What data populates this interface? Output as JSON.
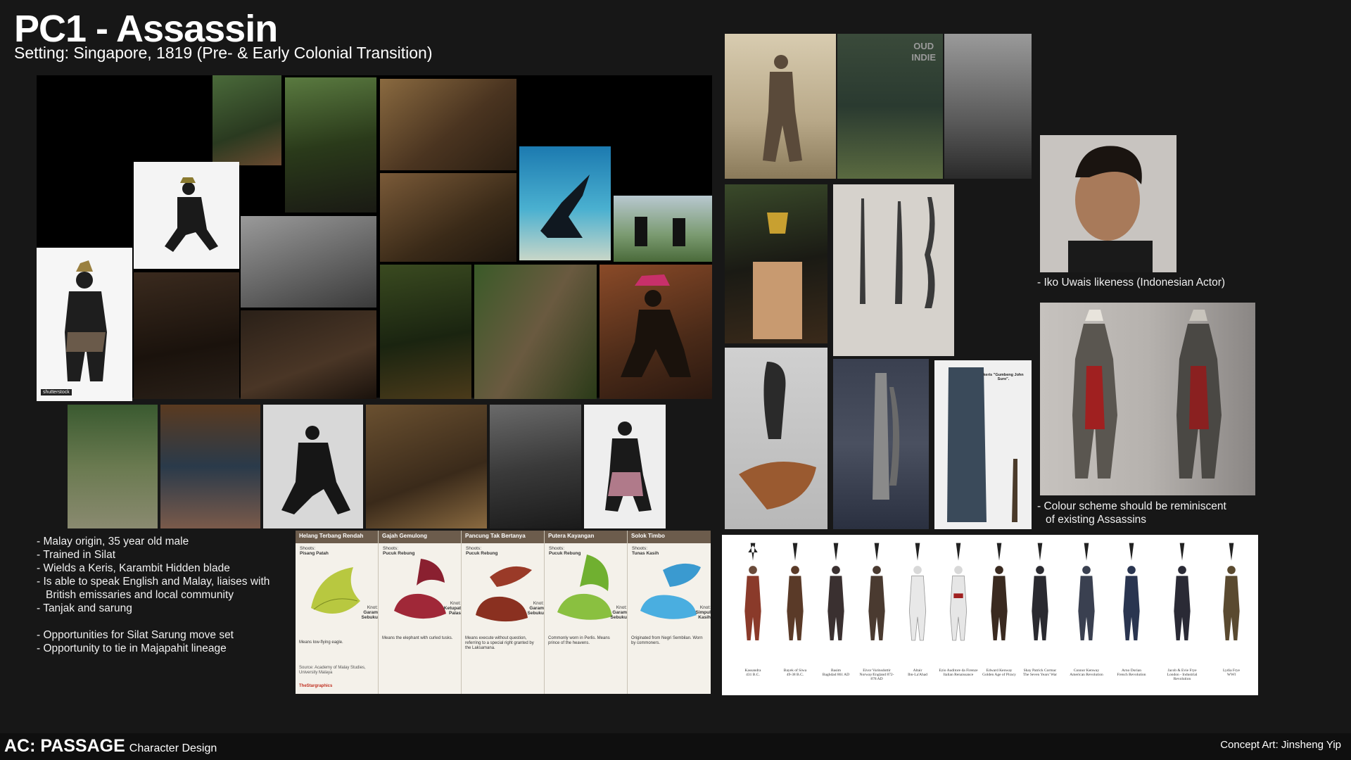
{
  "header": {
    "title": "PC1 - Assassin",
    "subtitle": "Setting: Singapore, 1819 (Pre- & Early Colonial Transition)"
  },
  "notes": {
    "items": [
      "-  Malay origin, 35 year old male",
      "-  Trained in Silat",
      "-  Wields a Keris, Karambit Hidden blade",
      "-  Is able to speak English and Malay, liaises with",
      "British emissaries and local community",
      "-  Tanjak and sarung",
      "",
      "-  Opportunities for Silat Sarung move set",
      "-  Opportunity to tie in Majapahit lineage"
    ]
  },
  "captions": {
    "actor": "-  Iko Uwais likeness (Indonesian Actor)",
    "colour_line1": "-  Colour scheme should be reminiscent",
    "colour_line2": "of existing Assassins"
  },
  "watermarks": {
    "shutterstock": "shutterstock",
    "oud": "OUD",
    "indie": "INDIE"
  },
  "keris_note": {
    "title": "keris \"Gumbeng John Suro\"."
  },
  "tanjak": {
    "columns": [
      {
        "name": "Helang Terbang Rendah",
        "shoots_label": "Shoots:",
        "shoots": "Pisang Patah",
        "knot_label": "Knot:",
        "knot": "Garam Sebuku",
        "desc": "Means low-flying eagle."
      },
      {
        "name": "Gajah Gemulong",
        "shoots_label": "Shoots:",
        "shoots": "Pucuk Rebung",
        "knot_label": "Knot:",
        "knot": "Ketupat Palas",
        "desc": "Means the elephant with curled tusks."
      },
      {
        "name": "Pancung Tak Bertanya",
        "shoots_label": "Shoots:",
        "shoots": "Pucuk Rebung",
        "knot_label": "Knot:",
        "knot": "Garam Sebuku",
        "desc": "Means execute without question, referring to a special right granted by the Laksamana."
      },
      {
        "name": "Putera Kayangan",
        "shoots_label": "Shoots:",
        "shoots": "Pucuk Rebung",
        "knot_label": "Knot:",
        "knot": "Garam Sebuku",
        "desc": "Commonly worn in Perlis. Means prince of the heavens."
      },
      {
        "name": "Solok Timbo",
        "shoots_label": "Shoots:",
        "shoots": "Tunas Kasih",
        "knot_label": "Knot:",
        "knot": "Simpul Kasih",
        "desc": "Originated from Negri Sembilan. Worn by commoners."
      }
    ],
    "source": "Source: Academy of Malay Studies, University Malaya",
    "brand": "TheStargraphics"
  },
  "lineup": {
    "figures": [
      {
        "name": "Kassandra",
        "era": "431 B.C.",
        "color": "#8a3a2a"
      },
      {
        "name": "Bayek of Siwa",
        "era": "49-38 B.C.",
        "color": "#5a3a28"
      },
      {
        "name": "Basim",
        "era": "Baghdad 861 AD",
        "color": "#3a3030"
      },
      {
        "name": "Eivor Varinsdottir",
        "era": "Norway/England 872-878 AD",
        "color": "#4a3a30"
      },
      {
        "name": "Altair",
        "era": "Ibn-La'Ahad",
        "color": "#e8e8e8"
      },
      {
        "name": "Ezio Auditore da Firenze",
        "era": "Italian Renaissance",
        "color": "#e6e6e6"
      },
      {
        "name": "Edward Kenway",
        "era": "Golden Age of Piracy",
        "color": "#3a2a20"
      },
      {
        "name": "Shay Patrick Cormac",
        "era": "The Seven Years' War",
        "color": "#2a2a30"
      },
      {
        "name": "Connor Kenway",
        "era": "American Revolution",
        "color": "#3a4050"
      },
      {
        "name": "Arno Dorian",
        "era": "French Revolution",
        "color": "#2a3550"
      },
      {
        "name": "Jacob & Evie Frye",
        "era": "London - Industrial Revolution",
        "color": "#2a2a35"
      },
      {
        "name": "Lydia Frye",
        "era": "WWI",
        "color": "#5a4a30"
      }
    ]
  },
  "footer": {
    "brand_bold": "AC: PASSAGE",
    "brand_sub": "Character Design",
    "credit": "Concept Art: Jinsheng Yip"
  }
}
